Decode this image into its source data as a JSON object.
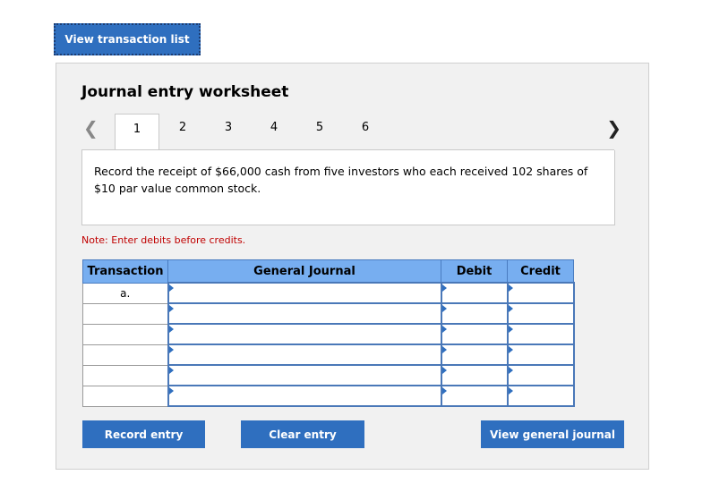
{
  "top_button": {
    "label": "View transaction list"
  },
  "worksheet": {
    "title": "Journal entry worksheet",
    "tabs": [
      "1",
      "2",
      "3",
      "4",
      "5",
      "6"
    ],
    "active_tab": "1",
    "description": "Record the receipt of $66,000 cash from five investors who each received 102 shares of $10 par value common stock.",
    "note": "Note: Enter debits before credits."
  },
  "journal_table": {
    "headers": {
      "transaction": "Transaction",
      "general_journal": "General Journal",
      "debit": "Debit",
      "credit": "Credit"
    },
    "rows": [
      {
        "transaction": "a.",
        "account": "",
        "debit": "",
        "credit": ""
      },
      {
        "transaction": "",
        "account": "",
        "debit": "",
        "credit": ""
      },
      {
        "transaction": "",
        "account": "",
        "debit": "",
        "credit": ""
      },
      {
        "transaction": "",
        "account": "",
        "debit": "",
        "credit": ""
      },
      {
        "transaction": "",
        "account": "",
        "debit": "",
        "credit": ""
      },
      {
        "transaction": "",
        "account": "",
        "debit": "",
        "credit": ""
      }
    ]
  },
  "buttons": {
    "record": "Record entry",
    "clear": "Clear entry",
    "view_journal": "View general journal"
  },
  "colors": {
    "primary_button": "#2f6fbf",
    "table_header": "#77aef0",
    "note_text": "#c00000"
  }
}
